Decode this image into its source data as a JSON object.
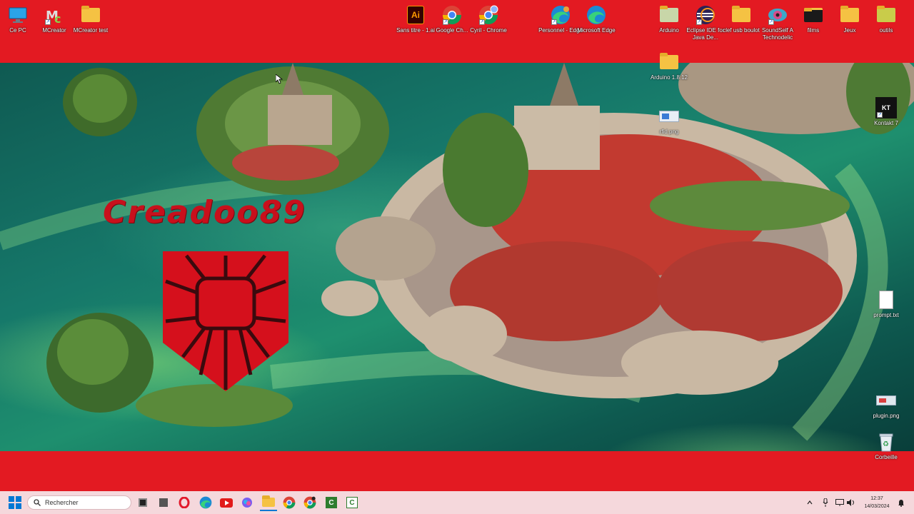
{
  "desktop": {
    "icons_top": [
      {
        "label": "Ce PC",
        "icon": "computer-icon"
      },
      {
        "label": "MCreator",
        "icon": "mcreator-icon"
      },
      {
        "label": "MCreator test",
        "icon": "folder-icon"
      },
      {
        "label": "Sans titre - 1.ai",
        "icon": "illustrator-icon"
      },
      {
        "label": "Google Ch...",
        "icon": "chrome-icon"
      },
      {
        "label": "Cyril - Chrome",
        "icon": "chrome-profile-icon"
      },
      {
        "label": "Personnel - Edge",
        "icon": "edge-icon"
      },
      {
        "label": "Microsoft Edge",
        "icon": "edge-icon"
      },
      {
        "label": "Arduino",
        "icon": "folder-icon"
      },
      {
        "label": "Eclipse IDE for Java De...",
        "icon": "eclipse-icon"
      },
      {
        "label": "clef usb boulot",
        "icon": "folder-icon"
      },
      {
        "label": "SoundSelf A Technodelic",
        "icon": "soundself-icon"
      },
      {
        "label": "films",
        "icon": "folder-dark-icon"
      },
      {
        "label": "Jeux",
        "icon": "folder-icon"
      },
      {
        "label": "outils",
        "icon": "folder-green-icon"
      }
    ],
    "icons_right": [
      {
        "label": "Arduino 1.8.12",
        "icon": "folder-icon"
      },
      {
        "label": "rfid.png",
        "icon": "image-file-icon"
      },
      {
        "label": "Kontakt 7",
        "icon": "kontakt-icon",
        "glyph": "KT"
      },
      {
        "label": "prompt.txt",
        "icon": "text-file-icon"
      },
      {
        "label": "plugin.png",
        "icon": "image-file-icon"
      },
      {
        "label": "Corbeille",
        "icon": "recycle-bin-icon"
      }
    ],
    "wallpaper_logo_text": "Creadoo89"
  },
  "taskbar": {
    "search_placeholder": "Rechercher",
    "clock_time": "12:37",
    "clock_date": "14/03/2024",
    "illustrator_glyph": "Ai"
  },
  "colors": {
    "band_red": "#e31a22",
    "taskbar_bg": "#f5d8dc",
    "logo_red": "#c8101c",
    "folder_yellow": "#f5c243"
  }
}
